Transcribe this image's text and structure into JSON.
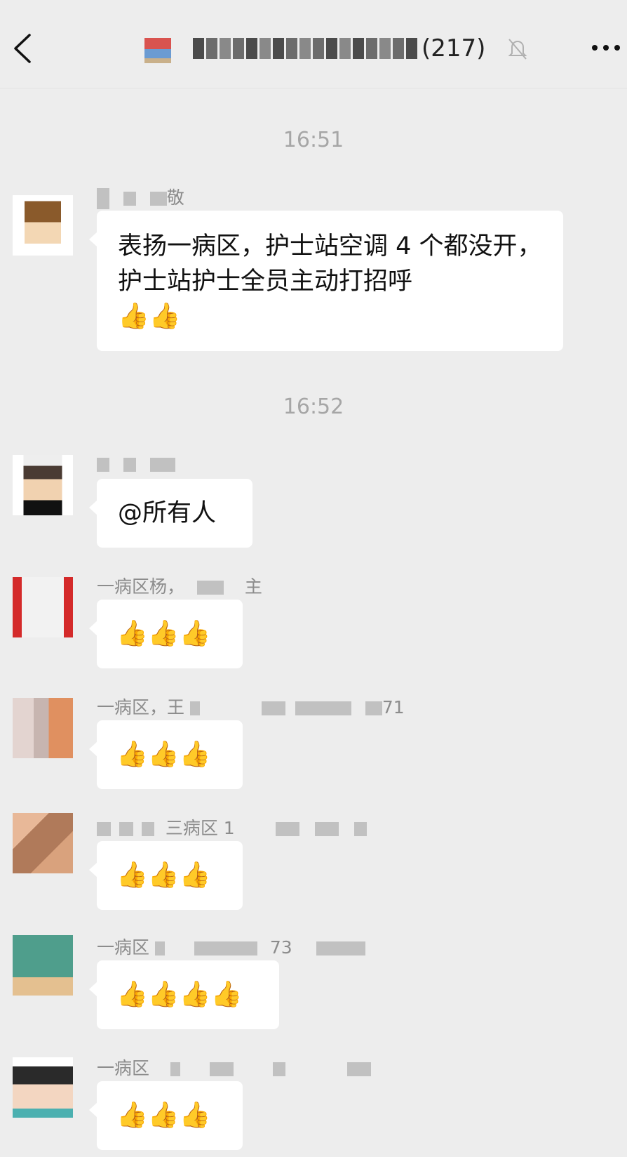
{
  "header": {
    "back_icon": "chevron-left-icon",
    "count_text": "(217)",
    "mute_icon": "bell-off-icon",
    "more_icon": "more-dots-icon"
  },
  "messages": {
    "time_1": "16:51",
    "msg1_sender_visible": "敬",
    "msg1_text": "表扬一病区，护士站空调 4 个都没开，护士站护士全员主动打招呼",
    "msg1_emoji": "👍👍",
    "time_2": "16:52",
    "msg2_text": "@所有人",
    "msg3_sender": "一病区杨，",
    "msg3_sender_tail": "主",
    "msg3_emoji": "👍👍👍",
    "msg4_sender": "一病区，王",
    "msg4_sender_tail": "71",
    "msg4_emoji": "👍👍👍",
    "msg5_sender": "三病区 1",
    "msg5_emoji": "👍👍👍",
    "msg6_sender": "一病区",
    "msg6_sender_tail": "73",
    "msg6_emoji": "👍👍👍👍",
    "msg7_sender": "一病区",
    "msg7_emoji": "👍👍👍"
  },
  "colors": {
    "background": "#ededed",
    "bubble": "#ffffff",
    "thumb": "#f5b400"
  }
}
